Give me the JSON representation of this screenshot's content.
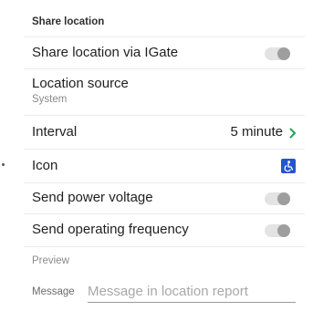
{
  "section_title": "Share location",
  "items": {
    "share_igate": {
      "label": "Share location via IGate",
      "enabled": false
    },
    "location_source": {
      "label": "Location source",
      "value": "System"
    },
    "interval": {
      "label": "Interval",
      "value": "5 minute"
    },
    "icon": {
      "label": "Icon"
    },
    "power_voltage": {
      "label": "Send power voltage",
      "enabled": false
    },
    "operating_frequency": {
      "label": "Send operating frequency",
      "enabled": false
    }
  },
  "preview": {
    "label": "Preview",
    "message_label": "Message",
    "message_value": "",
    "message_placeholder": "Message in location report"
  },
  "colors": {
    "accent_green": "#1fa35b",
    "icon_blue": "#2456c9",
    "toggle_track": "#e3e3e3",
    "toggle_knob": "#9e9e9e"
  }
}
